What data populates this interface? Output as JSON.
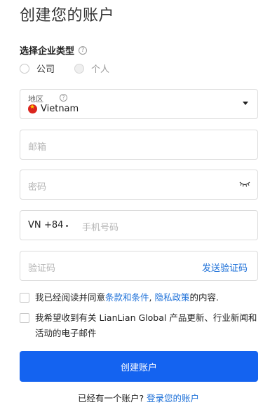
{
  "title": "创建您的账户",
  "enterprise_type": {
    "label": "选择企业类型",
    "options": [
      "公司",
      "个人"
    ]
  },
  "region": {
    "label": "地区",
    "value": "Vietnam",
    "flag_colors": {
      "background": "#da251d",
      "star": "#ffcd00"
    }
  },
  "email": {
    "placeholder": "邮箱"
  },
  "password": {
    "placeholder": "密码"
  },
  "phone": {
    "country": "VN",
    "code": "+84",
    "placeholder": "手机号码"
  },
  "verification": {
    "placeholder": "验证码",
    "send_label": "发送验证码"
  },
  "terms": {
    "prefix": "我已经阅读并同意",
    "terms_link": "条款和条件",
    "separator": ", ",
    "privacy_link": "隐私政策",
    "suffix": "的内容."
  },
  "marketing": {
    "text": "我希望收到有关 LianLian Global 产品更新、行业新闻和活动的电子邮件"
  },
  "submit_label": "创建账户",
  "login": {
    "prefix": "已经有一个账户? ",
    "link": "登录您的账户"
  },
  "colors": {
    "accent": "#1463f0",
    "link": "#1b6fd8"
  }
}
